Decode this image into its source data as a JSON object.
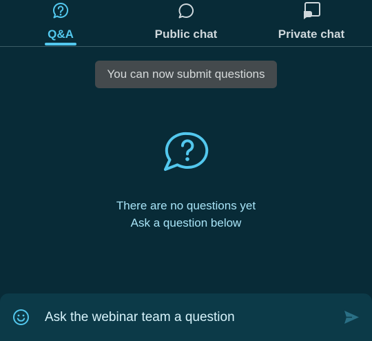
{
  "tabs": [
    {
      "label": "Q&A",
      "icon": "question-bubble-icon",
      "active": true
    },
    {
      "label": "Public chat",
      "icon": "chat-bubble-icon",
      "active": false
    },
    {
      "label": "Private chat",
      "icon": "private-chat-icon",
      "active": false
    }
  ],
  "toast": {
    "text": "You can now submit questions"
  },
  "empty_state": {
    "icon": "question-bubble-icon",
    "line1": "There are no questions yet",
    "line2": "Ask a question below"
  },
  "composer": {
    "placeholder": "Ask the webinar team a question",
    "emoji_icon": "smiley-icon",
    "send_icon": "send-icon"
  },
  "colors": {
    "background": "#082b37",
    "accent": "#53c8ee",
    "composer": "#0c3a48",
    "toast": "#444a4d"
  }
}
